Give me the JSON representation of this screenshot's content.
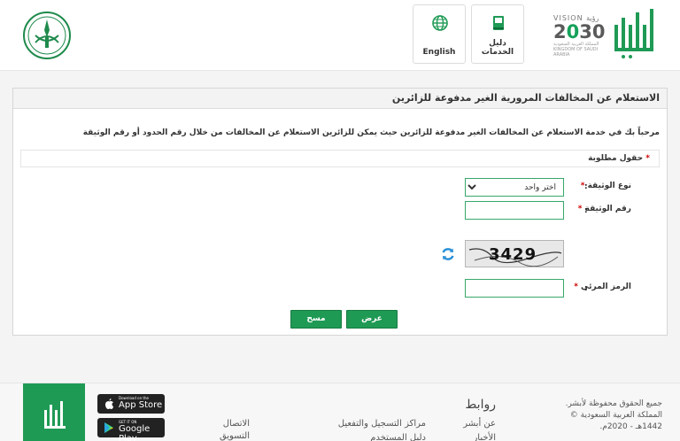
{
  "header": {
    "english_label": "English",
    "guide_label": "دليل الخدمات",
    "vision_top": "VISION رؤية",
    "vision_num_a": "2",
    "vision_num_b": "0",
    "vision_num_c": "30",
    "vision_sub": "المملكة العربية السعودية KINGDOM OF SAUDI ARABIA"
  },
  "panel": {
    "title": "الاستعلام عن المخالفات المرورية الغير مدفوعة للزائرين",
    "intro": "مرحباً بك في خدمة الاستعلام عن المخالفات الغير مدفوعة للزائرين حيث يمكن للزائرين الاستعلام عن المخالفات من خلال رقم الحدود أو رقم الوثيقة",
    "required_star": "*",
    "required_label": "حقول مطلوبة",
    "doc_type_label": "نوع الوثيقة",
    "doc_number_label": "رقم الوثيقة",
    "captcha_label": "الرمز المرئي",
    "colon": ":",
    "select_selected": "اختر واحد",
    "captcha_text": "3429",
    "submit_label": "عرض",
    "clear_label": "مسح"
  },
  "footer": {
    "copy1": "جميع الحقوق محفوظة لأبشر.",
    "copy2": "المملكة العربية السعودية ©",
    "copy3": "1442هـ - 2020م.",
    "links_title": "روابط",
    "link_about": "عن أبشر",
    "link_extra": "الأخبار",
    "link_centers": "مراكز التسجيل والتفعيل",
    "link_user_guide": "دليل المستخدم",
    "link_contact": "الاتصال",
    "link_marketing": "التسويق",
    "appstore_small": "Download on the",
    "appstore_big": "App Store",
    "play_small": "GET IT ON",
    "play_big": "Google Play"
  },
  "colors": {
    "accent": "#1f9a55",
    "required": "#d00000"
  }
}
